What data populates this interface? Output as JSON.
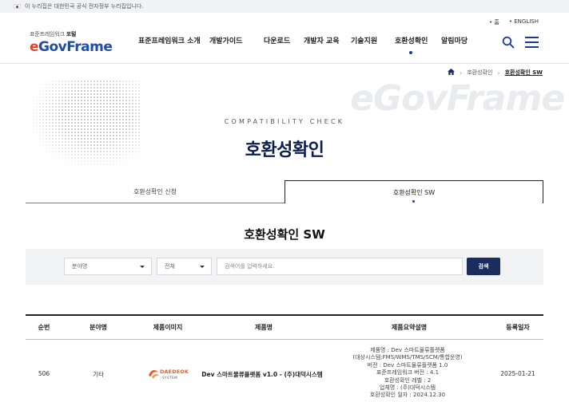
{
  "gov_banner": {
    "text": "이 누리집은 대한민국 공식 전자정부 누리집입니다."
  },
  "util_links": [
    "홈",
    "ENGLISH"
  ],
  "logo": {
    "sub_prefix": "표준프레임워크",
    "sub_bold": "포털",
    "main_e": "e",
    "main_rest": "GovFrame"
  },
  "nav": {
    "items": [
      "표준프레임워크 소개",
      "개발가이드",
      "다운로드",
      "개발자 교육",
      "기술지원",
      "호환성확인",
      "알림마당"
    ],
    "active": "호환성확인"
  },
  "header_icons": [
    "search-icon",
    "hamburger-menu-icon"
  ],
  "breadcrumb": {
    "items": [
      "호환성확인",
      "호환성확인 SW"
    ]
  },
  "hero": {
    "watermark": "eGovFrame",
    "eyebrow": "COMPATIBILITY CHECK",
    "title": "호환성확인"
  },
  "tabs": {
    "items": [
      "호환성확인 신청",
      "호환성확인 SW"
    ],
    "active": "호환성확인 SW"
  },
  "section_title": "호환성확인 SW",
  "search": {
    "field_select": "분야명",
    "scope_select": "전체",
    "input_value": "",
    "input_placeholder": "검색어를 입력하세요.",
    "button_label": "검색"
  },
  "table": {
    "headers": [
      "순번",
      "분야명",
      "제품이미지",
      "제품명",
      "제품요약설명",
      "등록일자"
    ],
    "rows": [
      {
        "no": "506",
        "field": "기타",
        "image_alt": "DAEDEOK SYSTEM",
        "product": "Dev 스마트물류플랫폼 v1.0 - (주)대덕시스템",
        "summary": [
          "제품명 : Dev 스마트물류플랫폼",
          "(대상시스템:FMS/WMS/TMS/SCM/통합운영)",
          "버전 : Dev 스마트물류플랫폼 1.0",
          "표준프레임워크 버전 : 4.1",
          "호환성확인 레벨 : 2",
          "업체명 : (주)대덕시스템",
          "호환성확인 일자 : 2024.12.30"
        ],
        "date": "2025-01-21"
      }
    ]
  },
  "colors": {
    "brand_navy": "#1b2d5e",
    "title_navy": "#0b1d4f",
    "logo_red": "#e8412d",
    "logo_blue": "#1d4fa8",
    "product_logo_orange": "#e8612c"
  }
}
